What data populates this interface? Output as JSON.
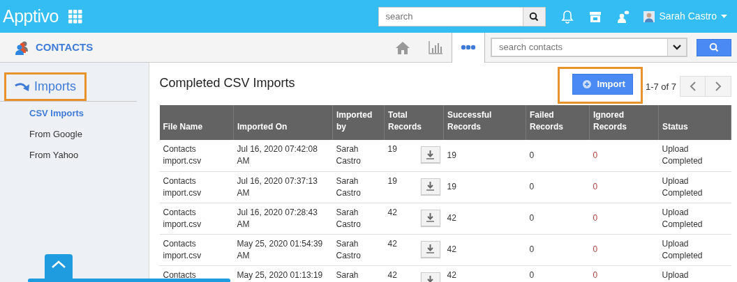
{
  "topbar": {
    "logo": "Apptivo",
    "search": {
      "placeholder": "search"
    },
    "user": "Sarah Castro"
  },
  "subbar": {
    "app_title": "CONTACTS",
    "tabs": [
      {
        "kind": "home",
        "selected": false
      },
      {
        "kind": "chart",
        "selected": false
      },
      {
        "kind": "more",
        "selected": true
      }
    ],
    "search": {
      "placeholder": "search contacts"
    }
  },
  "sidebar": {
    "heading": "Imports",
    "highlighted": true,
    "items": [
      {
        "label": "CSV Imports",
        "selected": true
      },
      {
        "label": "From Google",
        "selected": false
      },
      {
        "label": "From Yahoo",
        "selected": false
      }
    ]
  },
  "main": {
    "title": "Completed CSV Imports",
    "import_button": {
      "label": "Import",
      "highlighted": true
    },
    "pagination": "1-7 of 7",
    "table": {
      "columns": [
        "File Name",
        "Imported On",
        "Imported by",
        "Total Records",
        "Successful Records",
        "Failed Records",
        "Ignored Records",
        "Status"
      ],
      "rows": [
        {
          "file_name": "Contacts import.csv",
          "imported_on": "Jul 16, 2020 07:42:08 AM",
          "imported_by": "Sarah Castro",
          "total": "19",
          "successful": "19",
          "failed": "0",
          "ignored": "0",
          "status": "Upload Completed"
        },
        {
          "file_name": "Contacts import.csv",
          "imported_on": "Jul 16, 2020 07:37:13 AM",
          "imported_by": "Sarah Castro",
          "total": "19",
          "successful": "19",
          "failed": "0",
          "ignored": "0",
          "status": "Upload Completed"
        },
        {
          "file_name": "Contacts import.csv",
          "imported_on": "Jul 16, 2020 07:28:43 AM",
          "imported_by": "Sarah Castro",
          "total": "42",
          "successful": "42",
          "failed": "0",
          "ignored": "0",
          "status": "Upload Completed"
        },
        {
          "file_name": "Contacts import.csv",
          "imported_on": "May 25, 2020 01:54:39 AM",
          "imported_by": "Sarah Castro",
          "total": "42",
          "successful": "42",
          "failed": "0",
          "ignored": "0",
          "status": "Upload Completed"
        },
        {
          "file_name": "Contacts",
          "imported_on": "May 25, 2020 01:13:19",
          "imported_by": "Sarah",
          "total": "42",
          "successful": "42",
          "failed": "0",
          "ignored": "0",
          "status": "Upload"
        }
      ]
    }
  }
}
